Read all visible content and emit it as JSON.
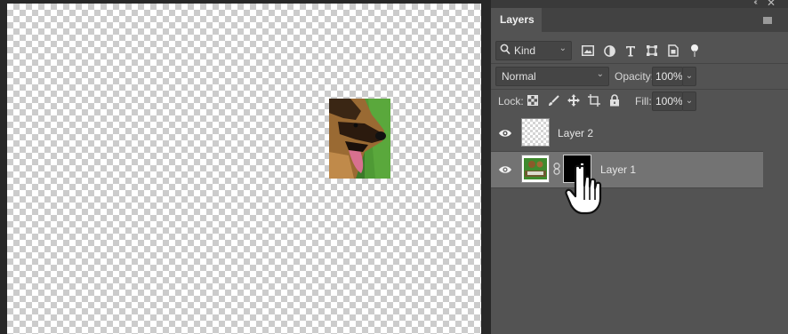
{
  "panel": {
    "title": "Layers",
    "collapse_icon": "double-chevron-left-icon",
    "close_icon": "close-icon",
    "menu_icon": "panel-menu-icon"
  },
  "filter": {
    "kind_label": "Kind",
    "icons": [
      "image-filter-icon",
      "adjustment-filter-icon",
      "type-filter-icon",
      "shape-filter-icon",
      "smart-object-filter-icon",
      "filter-toggle-icon"
    ]
  },
  "blend": {
    "mode": "Normal",
    "opacity_label": "Opacity:",
    "opacity_value": "100%"
  },
  "lock": {
    "label": "Lock:",
    "icons": [
      "lock-transparent-pixels-icon",
      "lock-image-pixels-icon",
      "lock-position-icon",
      "lock-artboard-icon",
      "lock-all-icon"
    ],
    "fill_label": "Fill:",
    "fill_value": "100%"
  },
  "layers": [
    {
      "name": "Layer 2",
      "visible": true,
      "selected": false,
      "has_mask": false
    },
    {
      "name": "Layer 1",
      "visible": true,
      "selected": true,
      "has_mask": true
    }
  ],
  "colors": {
    "panel_bg": "#535353",
    "selected_row": "#737373",
    "canvas_dark": "#282828"
  }
}
